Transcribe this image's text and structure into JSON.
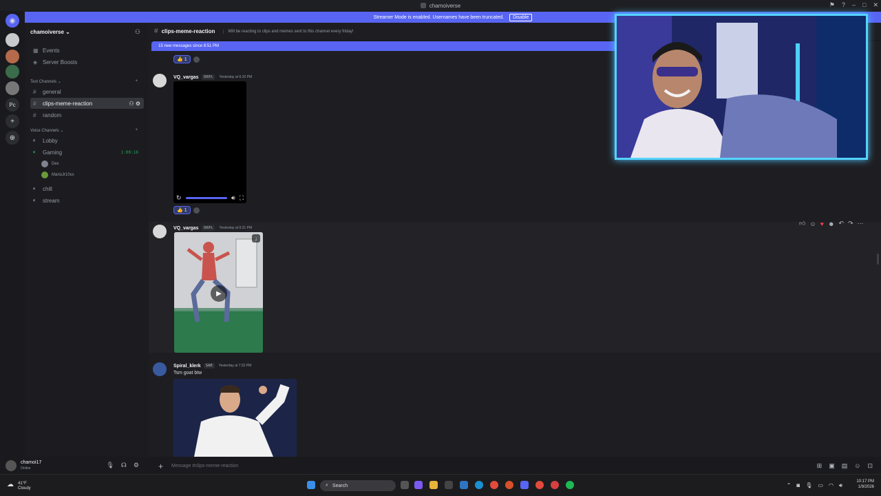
{
  "window": {
    "title": "chamoiverse"
  },
  "banner": {
    "text": "Streamer Mode is enabled. Usernames have been truncated.",
    "button": "Disable"
  },
  "guilds": {
    "pc_label": "Pc"
  },
  "server": {
    "name": "chamoiverse",
    "top_items": [
      {
        "label": "Events"
      },
      {
        "label": "Server Boosts"
      }
    ],
    "text_category": "Text Channels",
    "text_channels": [
      {
        "label": "general"
      },
      {
        "label": "clips-meme-reaction"
      },
      {
        "label": "random"
      }
    ],
    "voice_category": "Voice Channels",
    "voice_channels": [
      {
        "label": "Lobby"
      },
      {
        "label": "Gaming",
        "timer": "1:00:16"
      },
      {
        "label": "chill"
      },
      {
        "label": "stream"
      }
    ],
    "voice_users": [
      {
        "name": "Dex"
      },
      {
        "name": "MarioJr10ss"
      }
    ]
  },
  "user_panel": {
    "name": "chamoi17",
    "status": "Online"
  },
  "channel": {
    "name": "clips-meme-reaction",
    "topic": "Will be reacting to clips and memes sent to this channel every friday!",
    "new_messages": "15 new messages since 8:51 PM"
  },
  "reactions": [
    {
      "emoji": "👍",
      "count": "1"
    },
    {
      "emoji": "👍",
      "count": "1"
    }
  ],
  "messages": [
    {
      "author": "VQ_vargas",
      "tag": "SWFL",
      "time": "Yesterday at 6:10 PM"
    },
    {
      "author": "VQ_vargas",
      "tag": "SWFL",
      "time": "Yesterday at 6:21 PM"
    },
    {
      "author": "Spiral_klerk",
      "tag": "SAB",
      "time": "Yesterday at 7:32 PM",
      "text": "Tsm goat btw"
    }
  ],
  "input": {
    "placeholder": "Message #clips-meme-reaction"
  },
  "taskbar": {
    "weather_temp": "41°F",
    "weather_desc": "Cloudy",
    "search": "Search",
    "time": "10:17 PM",
    "date": "1/9/2026"
  },
  "colors": {
    "accent": "#5865f2",
    "webcam_border": "#55d4ff"
  }
}
